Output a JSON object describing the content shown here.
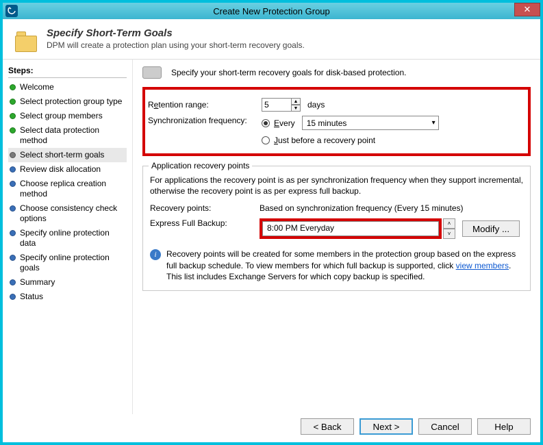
{
  "window": {
    "title": "Create New Protection Group"
  },
  "header": {
    "title": "Specify Short-Term Goals",
    "subtitle": "DPM will create a protection plan using your short-term recovery goals."
  },
  "sidebar": {
    "heading": "Steps:",
    "items": [
      {
        "label": "Welcome",
        "state": "done"
      },
      {
        "label": "Select protection group type",
        "state": "done"
      },
      {
        "label": "Select group members",
        "state": "done"
      },
      {
        "label": "Select data protection method",
        "state": "done"
      },
      {
        "label": "Select short-term goals",
        "state": "current"
      },
      {
        "label": "Review disk allocation",
        "state": "todo"
      },
      {
        "label": "Choose replica creation method",
        "state": "todo"
      },
      {
        "label": "Choose consistency check options",
        "state": "todo"
      },
      {
        "label": "Specify online protection data",
        "state": "todo"
      },
      {
        "label": "Specify online protection goals",
        "state": "todo"
      },
      {
        "label": "Summary",
        "state": "todo"
      },
      {
        "label": "Status",
        "state": "todo"
      }
    ]
  },
  "main": {
    "intro": "Specify your short-term recovery goals for disk-based protection.",
    "retention": {
      "label_pre": "R",
      "label_u": "e",
      "label_post": "tention range:",
      "value": "5",
      "unit": "days"
    },
    "sync": {
      "label": "Synchronization frequency:",
      "options": {
        "every": {
          "pre": "",
          "u": "E",
          "post": "very",
          "select_value": "15 minutes",
          "checked": true
        },
        "just": {
          "pre": "",
          "u": "J",
          "post": "ust before a recovery point",
          "checked": false
        }
      }
    },
    "group": {
      "title": "Application recovery points",
      "desc": "For applications the recovery point is as per synchronization frequency when they support incremental, otherwise the recovery point is as per express full backup.",
      "rp_label": "Recovery points:",
      "rp_value": "Based on synchronization frequency (Every 15 minutes)",
      "efb_label": "Express Full Backup:",
      "efb_value": "8:00 PM Everyday",
      "modify": "Modify ...",
      "info": {
        "pre": "Recovery points will be created for some members in the protection group based on the express full backup schedule. To view members for which full backup is supported, click ",
        "link": "view members",
        "post": ". This list includes Exchange Servers for which copy backup is specified."
      }
    }
  },
  "footer": {
    "back": "< Back",
    "next": "Next >",
    "cancel": "Cancel",
    "help": "Help"
  }
}
